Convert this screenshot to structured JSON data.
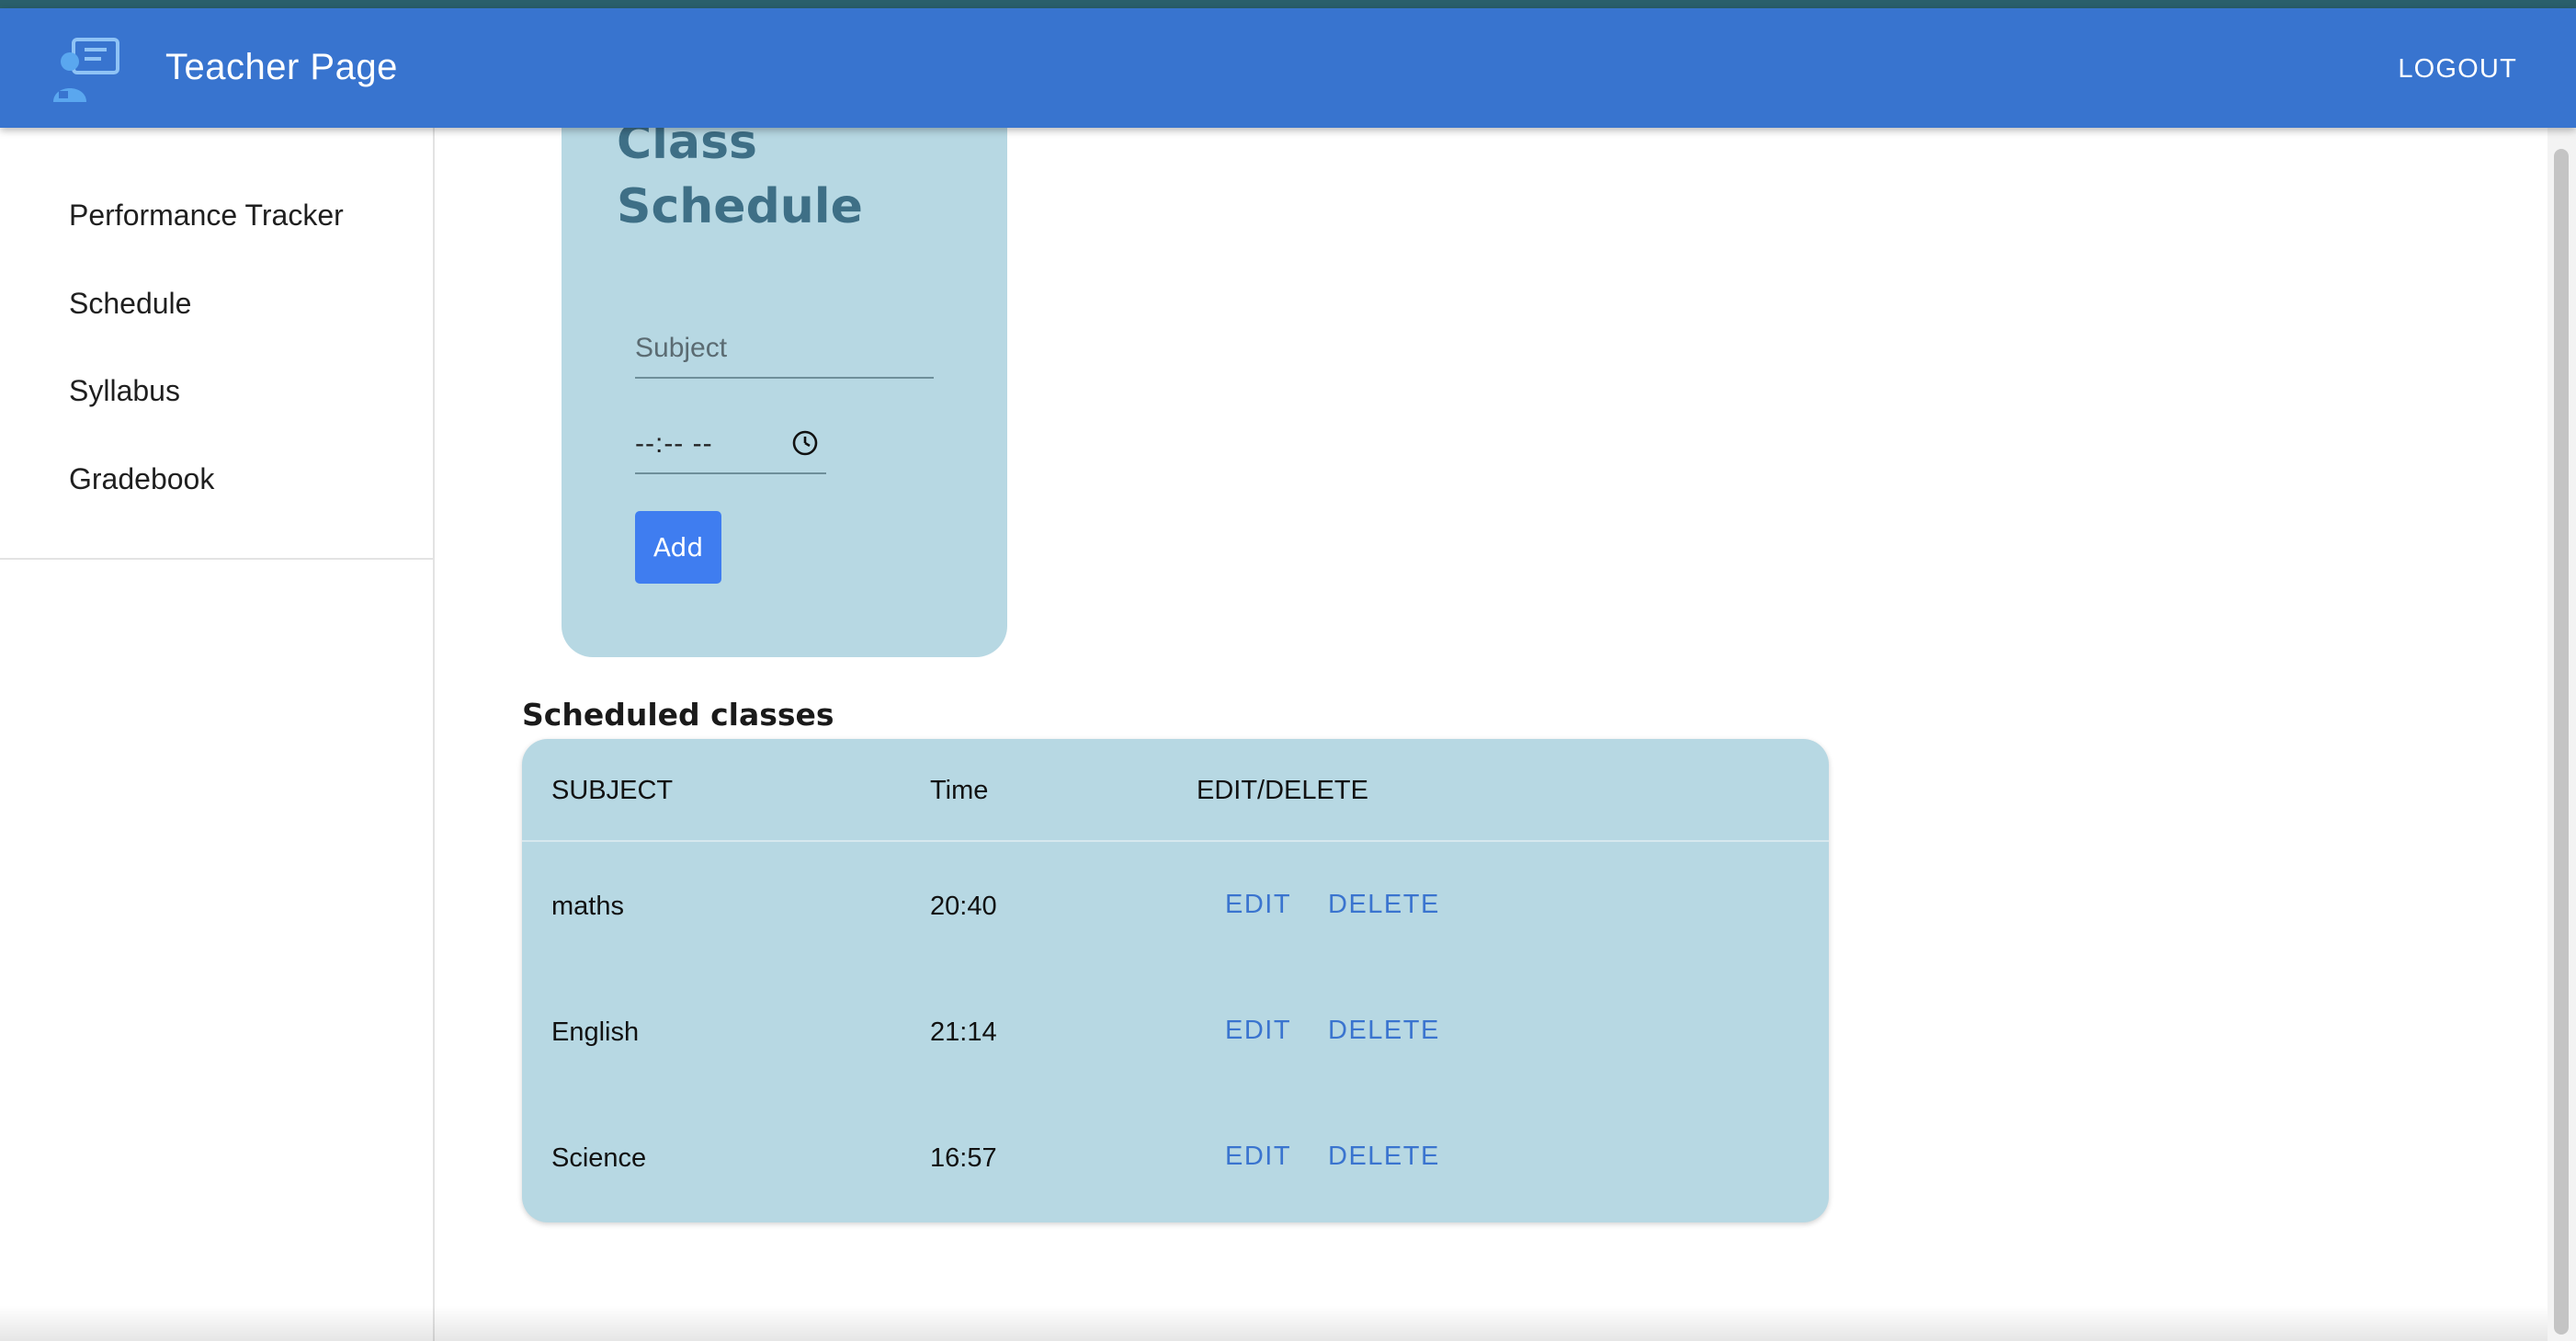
{
  "app": {
    "title": "Teacher Page",
    "logout_label": "LOGOUT",
    "logo_icon": "teacher-board-icon"
  },
  "colors": {
    "appbar": "#3874cf",
    "card": "#b7d8e3",
    "card_title": "#3e6f86",
    "button": "#3f7df0",
    "link": "#3a74cf"
  },
  "sidebar": {
    "items": [
      {
        "label": "Performance Tracker"
      },
      {
        "label": "Schedule"
      },
      {
        "label": "Syllabus"
      },
      {
        "label": "Gradebook"
      }
    ]
  },
  "form": {
    "title": "Class Schedule",
    "title_line1": "Class",
    "title_line2": "Schedule",
    "subject_placeholder": "Subject",
    "subject_value": "",
    "time_value": "--:-- --",
    "time_icon": "clock-icon",
    "add_label": "Add"
  },
  "schedule": {
    "heading": "Scheduled classes",
    "columns": [
      "SUBJECT",
      "Time",
      "EDIT/DELETE"
    ],
    "rows": [
      {
        "subject": "maths",
        "time": "20:40",
        "edit": "EDIT",
        "delete": "DELETE"
      },
      {
        "subject": "English",
        "time": "21:14",
        "edit": "EDIT",
        "delete": "DELETE"
      },
      {
        "subject": "Science",
        "time": "16:57",
        "edit": "EDIT",
        "delete": "DELETE"
      }
    ]
  }
}
